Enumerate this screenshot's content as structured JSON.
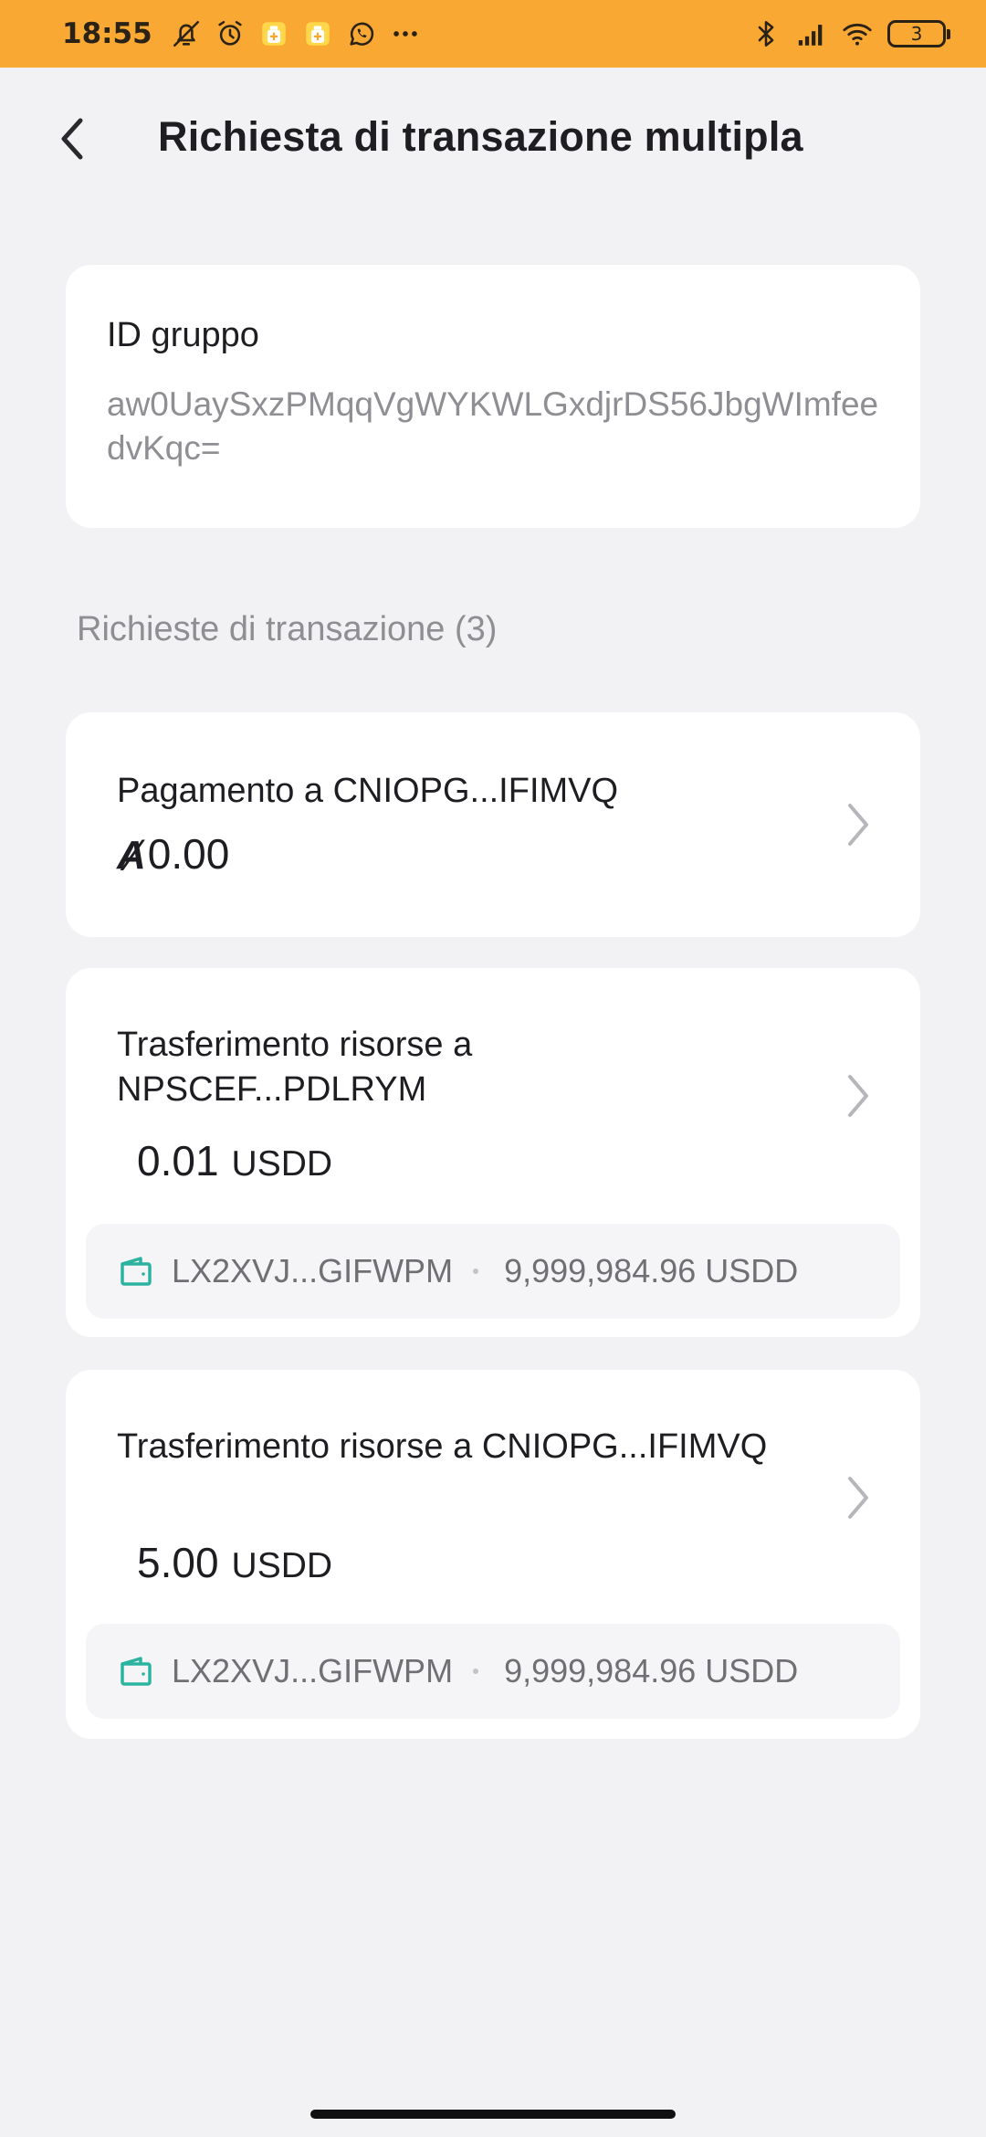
{
  "status_bar": {
    "time": "18:55",
    "battery": "3",
    "left_icons": [
      "bell-off-icon",
      "alarm-icon",
      "app-notification-icon",
      "app-notification-icon",
      "whatsapp-icon",
      "more-dots-icon"
    ],
    "right_icons": [
      "bluetooth-icon",
      "signal-icon",
      "wifi-icon",
      "battery-icon"
    ]
  },
  "header": {
    "title": "Richiesta di transazione multipla",
    "back_icon": "chevron-left-icon"
  },
  "group": {
    "label": "ID gruppo",
    "value": "aw0UaySxzPMqqVgWYKWLGxdjrDS56JbgWImfeedvKqc="
  },
  "requests": {
    "section_title": "Richieste di transazione (3)",
    "items": [
      {
        "title": "Pagamento a CNIOPG...IFIMVQ",
        "amount": "0.00",
        "asset_symbol": "Ⱥ"
      },
      {
        "title": "Trasferimento risorse a NPSCEF...PDLRYM",
        "amount": "0.01",
        "unit": "USDD",
        "account": "LX2XVJ...GIFWPM",
        "balance": "9,999,984.96 USDD"
      },
      {
        "title": "Trasferimento risorse a CNIOPG...IFIMVQ",
        "amount": "5.00",
        "unit": "USDD",
        "account": "LX2XVJ...GIFWPM",
        "balance": "9,999,984.96 USDD"
      }
    ]
  },
  "colors": {
    "status_bar_bg": "#f9a933",
    "page_bg": "#f2f2f4",
    "card_bg": "#ffffff",
    "wallet_icon": "#2bb3a0",
    "secondary_text": "#8e8e93"
  }
}
